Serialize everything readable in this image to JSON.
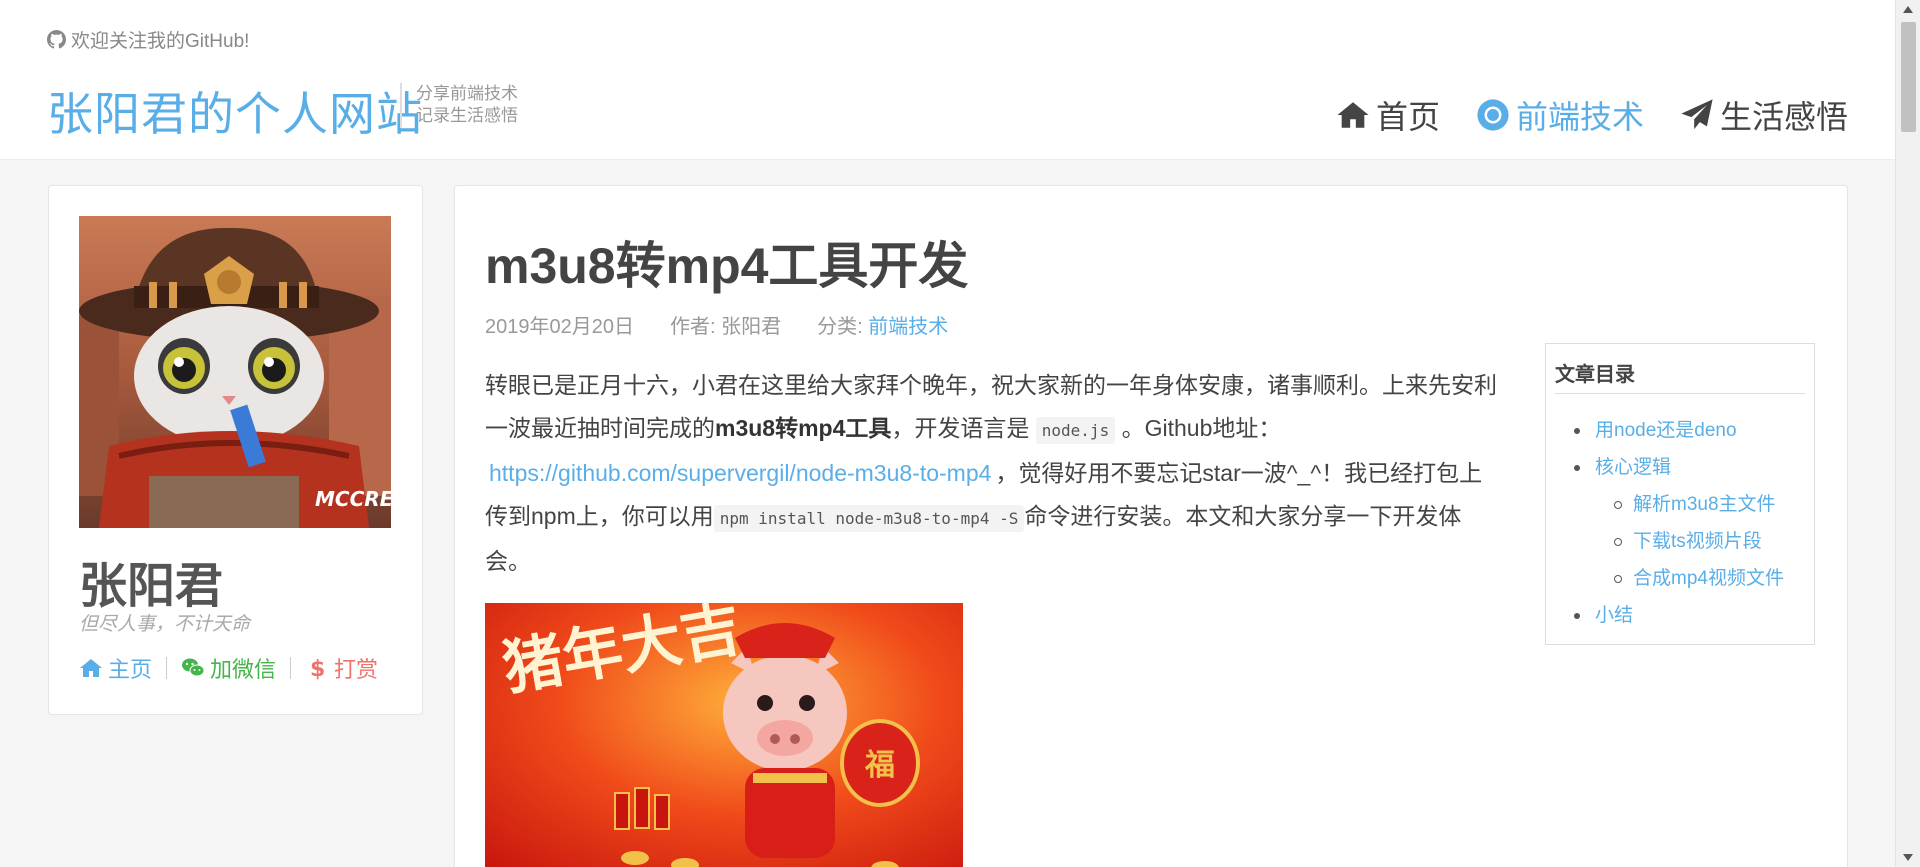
{
  "header": {
    "github_follow": "欢迎关注我的GitHub!",
    "site_title": "张阳君的个人网站",
    "tagline_line1": "分享前端技术",
    "tagline_line2": "记录生活感悟",
    "nav": [
      {
        "label": "首页",
        "icon": "home-icon",
        "active": false
      },
      {
        "label": "前端技术",
        "icon": "chrome-icon",
        "active": true
      },
      {
        "label": "生活感悟",
        "icon": "paper-plane-icon",
        "active": false
      }
    ]
  },
  "profile": {
    "name": "张阳君",
    "motto": "但尽人事，不计天命",
    "links": [
      {
        "label": "主页",
        "icon": "home-icon"
      },
      {
        "label": "加微信",
        "icon": "wechat-icon"
      },
      {
        "label": "打赏",
        "icon": "dollar-icon"
      }
    ],
    "avatar_caption": "MCCREE"
  },
  "article": {
    "title": "m3u8转mp4工具开发",
    "date": "2019年02月20日",
    "author": "作者: 张阳君",
    "category_label": "分类:",
    "category": "前端技术",
    "p1_a": "转眼已是正月十六，小君在这里给大家拜个晚年，祝大家新的一年身体安康，诸事顺利。上来先安利一波最近抽时间完成的",
    "p1_bold": "m3u8转mp4工具",
    "p1_b": "，开发语言是",
    "code1": "node.js",
    "p1_c": "。Github地址：",
    "github_url": "https://github.com/supervergil/node-m3u8-to-mp4",
    "p1_d": "，觉得好用不要忘记star一波^_^！我已经打包上传到npm上，你可以用",
    "code2": "npm install node-m3u8-to-mp4 -S",
    "p1_e": "命令进行安装。本文和大家分享一下开发体会。",
    "image_text": "猪年大吉",
    "image_badge": "福"
  },
  "toc": {
    "title": "文章目录",
    "items": [
      {
        "label": "用node还是deno"
      },
      {
        "label": "核心逻辑"
      },
      {
        "label": "解析m3u8主文件"
      },
      {
        "label": "下载ts视频片段"
      },
      {
        "label": "合成mp4视频文件"
      },
      {
        "label": "小结"
      }
    ]
  },
  "colors": {
    "accent": "#5aaee8",
    "wechat": "#44b549",
    "reward": "#f0736b"
  }
}
